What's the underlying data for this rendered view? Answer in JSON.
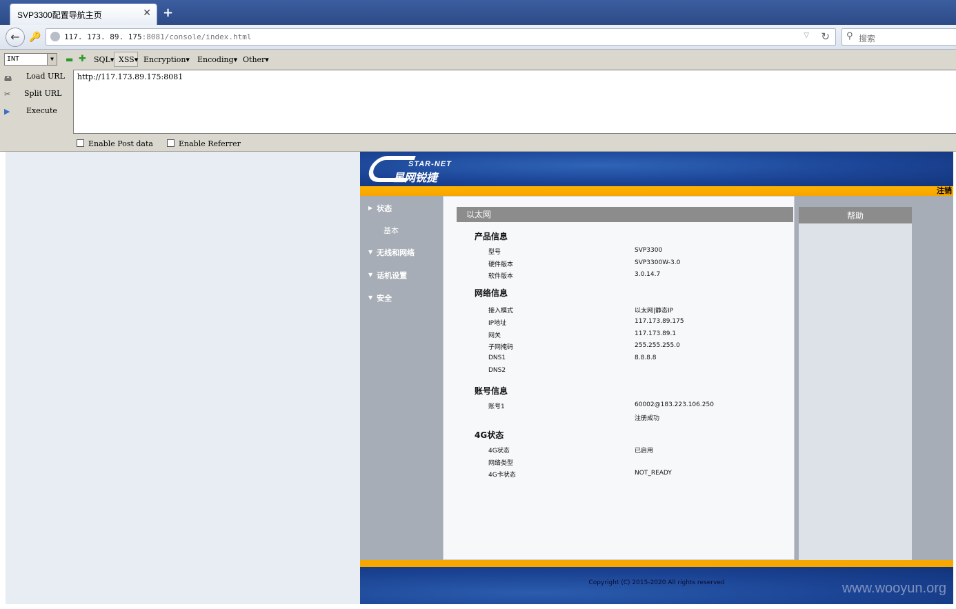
{
  "browser": {
    "tab_title": "SVP3300配置导航主页",
    "tab_close": "✕",
    "new_tab": "+",
    "url_host": "117. 173. 89. 175",
    "url_rest": ":8081/console/index.html",
    "search_placeholder": "搜索"
  },
  "hackbar": {
    "select_value": "INT",
    "menus": [
      "SQL▾",
      "XSS▾",
      "Encryption▾",
      "Encoding▾",
      "Other▾"
    ],
    "side_buttons": [
      "Load URL",
      "Split URL",
      "Execute"
    ],
    "url_value": "http://117.173.89.175:8081",
    "checkboxes": [
      "Enable Post data",
      "Enable Referrer"
    ]
  },
  "router": {
    "logo_en": "STAR-NET",
    "logo_cn": "星网锐捷",
    "logout": "注销",
    "nav": [
      "状态",
      "无线和网络",
      "话机设置",
      "安全"
    ],
    "nav_sub": "基本",
    "panel_title": "以太网",
    "help_title": "帮助",
    "sections": [
      {
        "title": "产品信息",
        "rows": [
          [
            "型号",
            "SVP3300"
          ],
          [
            "硬件版本",
            "SVP3300W-3.0"
          ],
          [
            "软件版本",
            "3.0.14.7"
          ]
        ]
      },
      {
        "title": "网络信息",
        "rows": [
          [
            "接入模式",
            "以太网|静态IP"
          ],
          [
            "IP地址",
            "117.173.89.175"
          ],
          [
            "网关",
            "117.173.89.1"
          ],
          [
            "子网掩码",
            "255.255.255.0"
          ],
          [
            "DNS1",
            "8.8.8.8"
          ],
          [
            "DNS2",
            ""
          ]
        ]
      },
      {
        "title": "账号信息",
        "rows": [
          [
            "账号1",
            "60002@183.223.106.250"
          ],
          [
            "",
            "注册成功"
          ]
        ]
      },
      {
        "title": "4G状态",
        "rows": [
          [
            "4G状态",
            "已启用"
          ],
          [
            "网络类型",
            ""
          ],
          [
            "4G卡状态",
            "NOT_READY"
          ]
        ]
      }
    ],
    "copyright": "Copyright (C) 2015-2020 All rights reserved",
    "watermark": "www.wooyun.org"
  }
}
